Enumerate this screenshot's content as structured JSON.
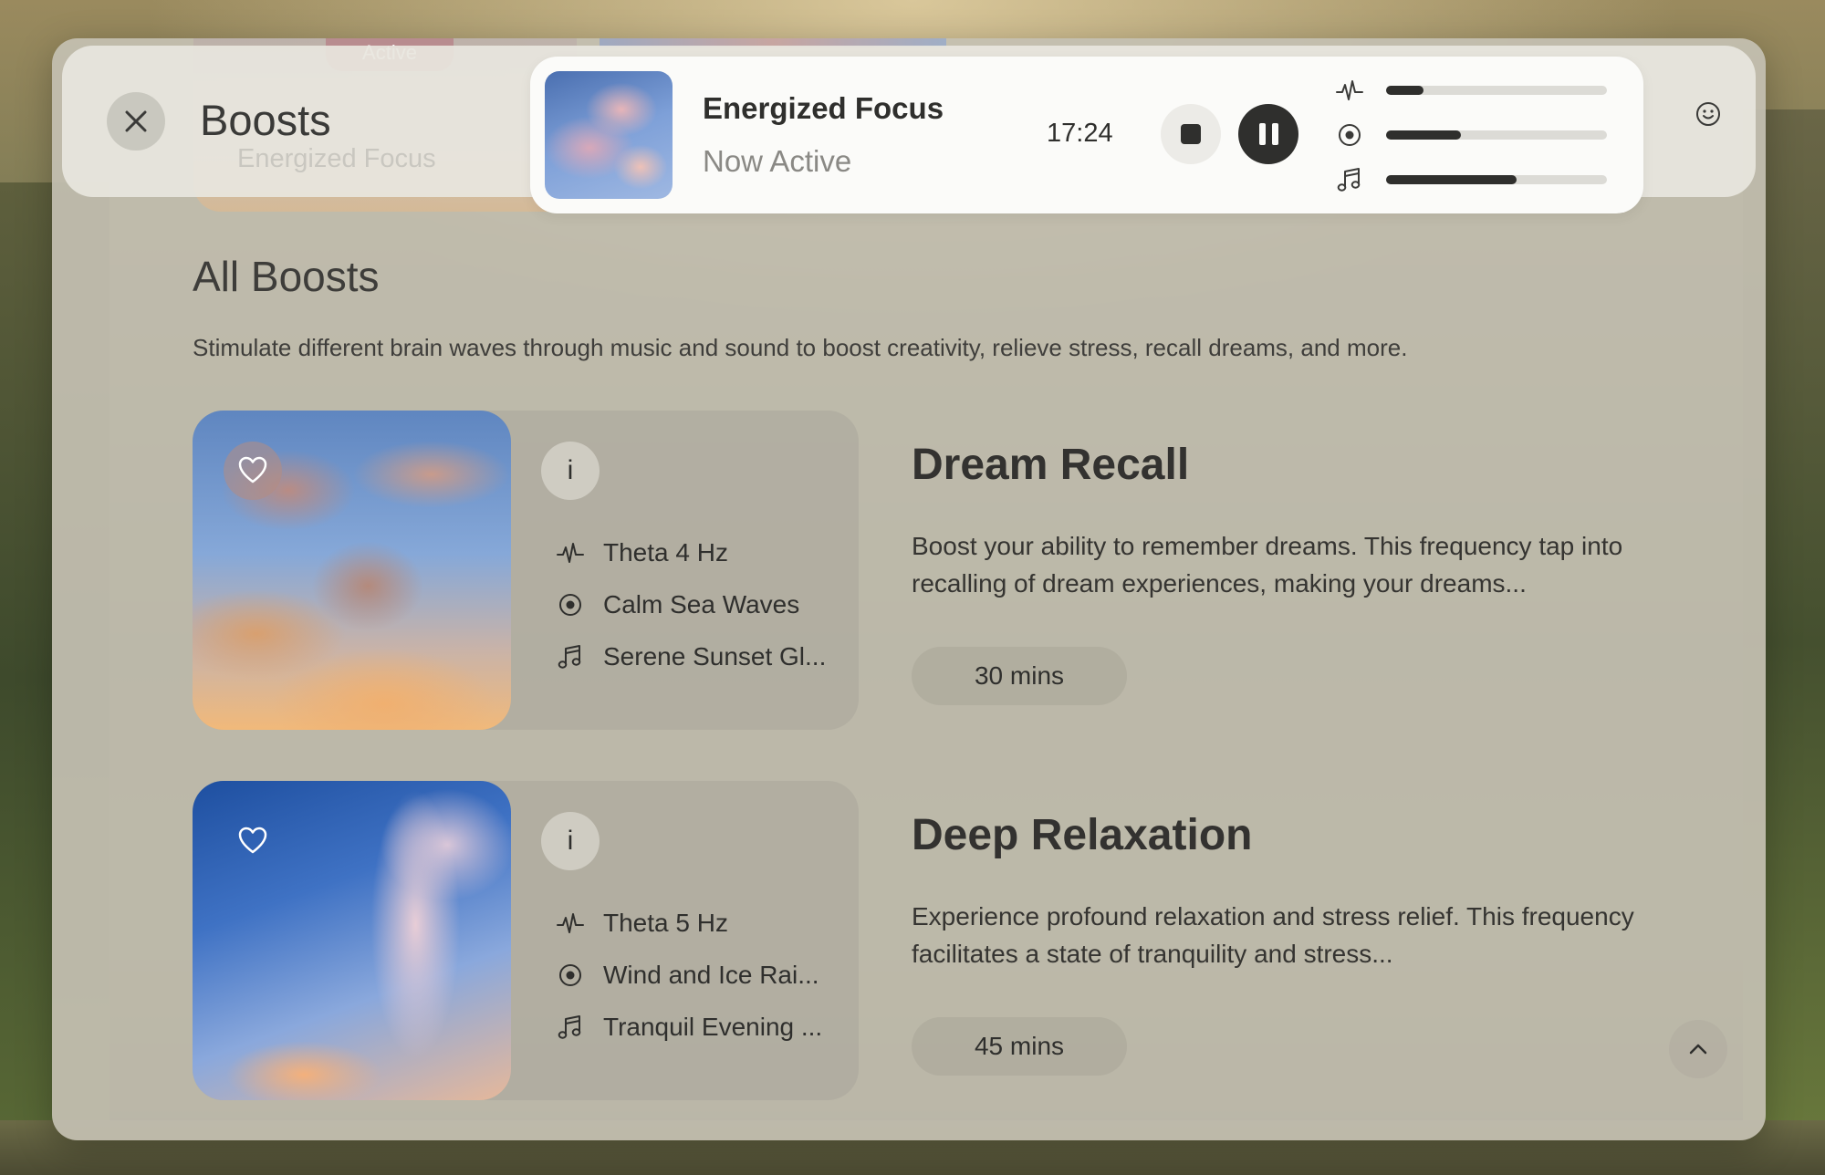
{
  "header": {
    "title": "Boosts",
    "subtitle": "Energized Focus",
    "peek_label": "Active"
  },
  "now_playing": {
    "title": "Energized Focus",
    "status": "Now Active",
    "time": "17:24",
    "mix": [
      {
        "icon": "waveform-icon",
        "level": 0.17
      },
      {
        "icon": "ambient-circle-icon",
        "level": 0.34
      },
      {
        "icon": "music-note-icon",
        "level": 0.59
      }
    ]
  },
  "section": {
    "title": "All Boosts",
    "description": "Stimulate different brain waves through music and sound to boost creativity, relieve stress, recall dreams, and more."
  },
  "boosts": [
    {
      "title": "Dream Recall",
      "frequency": "Theta 4 Hz",
      "ambient": "Calm Sea Waves",
      "music": "Serene Sunset Gl...",
      "description": "Boost your ability to remember dreams. This frequency tap into recalling of dream experiences, making your dreams...",
      "duration": "30 mins",
      "favorited": true
    },
    {
      "title": "Deep Relaxation",
      "frequency": "Theta 5 Hz",
      "ambient": "Wind and Ice Rai...",
      "music": "Tranquil Evening ...",
      "description": "Experience profound relaxation and stress relief. This frequency facilitates a state of tranquility and stress...",
      "duration": "45 mins",
      "favorited": false
    }
  ],
  "icons": {
    "close": "close-icon",
    "stop": "stop-icon",
    "pause": "pause-icon",
    "smiley": "smiley-icon",
    "heart": "heart-icon",
    "info": "info-icon",
    "chevron": "chevron-up-icon"
  },
  "colors": {
    "accent": "#2f2f2d",
    "panel": "#c4c0b2",
    "card": "#fbfbf9"
  }
}
